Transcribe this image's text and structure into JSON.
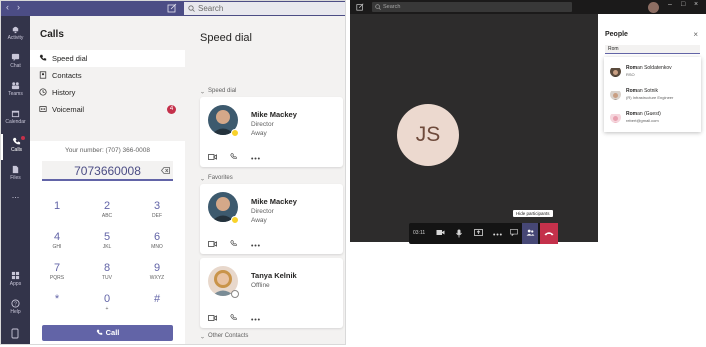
{
  "teams_window": {
    "search_placeholder": "Search",
    "rail": [
      {
        "label": "Activity",
        "icon": "bell-icon"
      },
      {
        "label": "Chat",
        "icon": "chat-icon"
      },
      {
        "label": "Teams",
        "icon": "teams-icon"
      },
      {
        "label": "Calendar",
        "icon": "calendar-icon"
      },
      {
        "label": "Calls",
        "icon": "phone-icon"
      },
      {
        "label": "Files",
        "icon": "file-icon"
      },
      {
        "label": "...",
        "icon": "more-icon"
      },
      {
        "label": "Apps",
        "icon": "apps-icon"
      },
      {
        "label": "Help",
        "icon": "help-icon"
      }
    ],
    "calls_title": "Calls",
    "nav": [
      {
        "label": "Speed dial"
      },
      {
        "label": "Contacts"
      },
      {
        "label": "History"
      },
      {
        "label": "Voicemail",
        "badge": "4"
      }
    ],
    "your_number": "Your number: (707) 366-0008",
    "dial_input": "7073660008",
    "keypad": [
      {
        "digit": "1",
        "letters": ""
      },
      {
        "digit": "2",
        "letters": "ABC"
      },
      {
        "digit": "3",
        "letters": "DEF"
      },
      {
        "digit": "4",
        "letters": "GHI"
      },
      {
        "digit": "5",
        "letters": "JKL"
      },
      {
        "digit": "6",
        "letters": "MNO"
      },
      {
        "digit": "7",
        "letters": "PQRS"
      },
      {
        "digit": "8",
        "letters": "TUV"
      },
      {
        "digit": "9",
        "letters": "WXYZ"
      },
      {
        "digit": "*",
        "letters": ""
      },
      {
        "digit": "0",
        "letters": "+"
      },
      {
        "digit": "#",
        "letters": ""
      }
    ],
    "call_button": "Call",
    "main_title": "Speed dial",
    "sections": [
      "Speed dial",
      "Favorites",
      "Other Contacts"
    ],
    "cards": [
      {
        "name": "Mike Mackey",
        "role": "Director",
        "status": "Away"
      },
      {
        "name": "Mike Mackey",
        "role": "Director",
        "status": "Away"
      },
      {
        "name": "Tanya Kelnik",
        "role": "",
        "status": "Offline"
      }
    ],
    "colors": {
      "brand": "#6264a7",
      "rail": "#33344a",
      "badge": "#c4314b",
      "away": "#f8d22a"
    }
  },
  "meeting_window": {
    "search_placeholder": "Search",
    "participant_initials": "JS",
    "timer": "03:11",
    "tooltip": "Hide participants",
    "people_title": "People",
    "people_search_value": "Rom",
    "people": [
      {
        "match": "Rom",
        "rest": "an Soldatenkov",
        "sub": "RSO"
      },
      {
        "match": "Rom",
        "rest": "an Sotnik",
        "sub": "(R) Infrastructure Engineer"
      },
      {
        "match": "Rom",
        "rest": "an (Guest)",
        "sub": "rebert@gmail.com"
      }
    ],
    "colors": {
      "end_call": "#c4314b",
      "stage": "#2d2c2c"
    }
  }
}
